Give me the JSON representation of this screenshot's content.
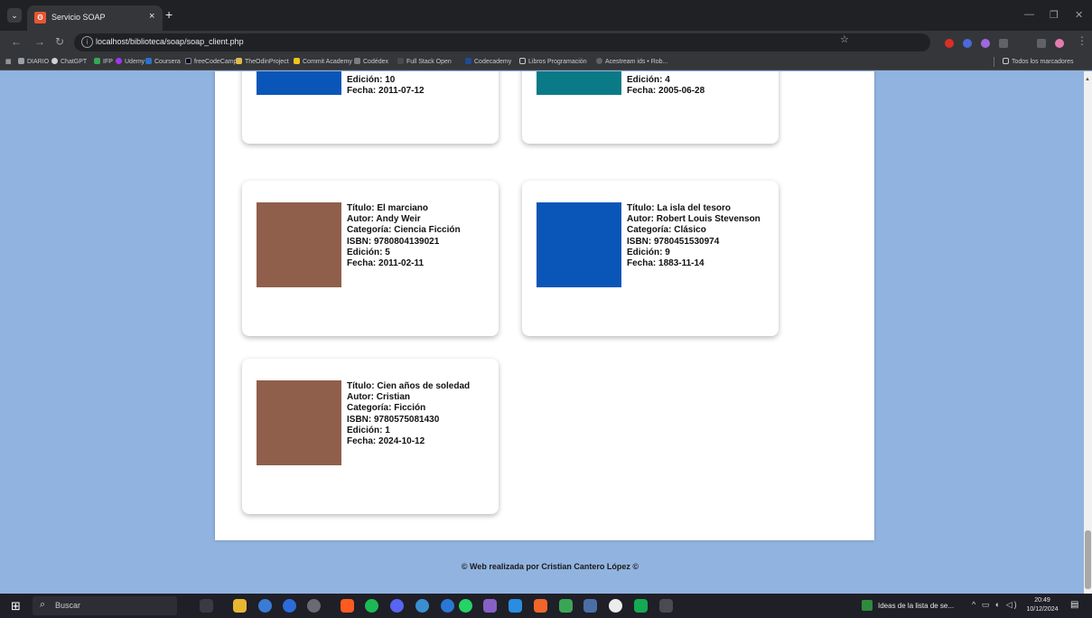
{
  "browser": {
    "tab_title": "Servicio SOAP",
    "tab_close": "×",
    "new_tab": "+",
    "url": "localhost/biblioteca/soap/soap_client.php",
    "bookmarks": [
      {
        "label": "DIARIO",
        "color": "#9aa0a6"
      },
      {
        "label": "ChatGPT",
        "color": "#cfd1d4"
      },
      {
        "label": "IFP",
        "color": "#35a853"
      },
      {
        "label": "Udemy",
        "color": "#a435f0"
      },
      {
        "label": "Coursera",
        "color": "#2a73cc"
      },
      {
        "label": "freeCodeCamp",
        "color": "#0a0a23"
      },
      {
        "label": "TheOdinProject",
        "color": "#e0b94b"
      },
      {
        "label": "Commit Academy",
        "color": "#f0c419"
      },
      {
        "label": "Codédex",
        "color": "#7d7d7d"
      },
      {
        "label": "Full Stack Open",
        "color": "#4a4a4a"
      },
      {
        "label": "Codecademy",
        "color": "#1f4b99"
      },
      {
        "label": "Libros Programación",
        "color": "#9aa0a6"
      },
      {
        "label": "Acestream ids • Rob...",
        "color": "#5f6368"
      }
    ],
    "all_bookmarks": "Todos los marcadores"
  },
  "books": [
    {
      "title": "",
      "author": "",
      "category": "",
      "isbn": "",
      "edition": "Edición: 10",
      "date": "Fecha: 2011-07-12",
      "cover_color": "#0a56b8"
    },
    {
      "title": "",
      "author": "",
      "category": "",
      "isbn": "",
      "edition": "Edición: 4",
      "date": "Fecha: 2005-06-28",
      "cover_color": "#0b7a87"
    },
    {
      "title": "Título: El marciano",
      "author": "Autor: Andy Weir",
      "category": "Categoría: Ciencia Ficción",
      "isbn": "ISBN: 9780804139021",
      "edition": "Edición: 5",
      "date": "Fecha: 2011-02-11",
      "cover_color": "#8f5f4b"
    },
    {
      "title": "Título: La isla del tesoro",
      "author": "Autor: Robert Louis Stevenson",
      "category": "Categoría: Clásico",
      "isbn": "ISBN: 9780451530974",
      "edition": "Edición: 9",
      "date": "Fecha: 1883-11-14",
      "cover_color": "#0a56b8"
    },
    {
      "title": "Título: Cien años de soledad",
      "author": "Autor: Cristian",
      "category": "Categoría: Ficción",
      "isbn": "ISBN: 9780575081430",
      "edition": "Edición: 1",
      "date": "Fecha: 2024-10-12",
      "cover_color": "#8f5f4b"
    }
  ],
  "footer": "© Web realizada por Cristian Cantero López ©",
  "taskbar": {
    "search_placeholder": "Buscar",
    "notification": "Ideas de la lista de se...",
    "time": "20:49",
    "date": "10/12/2024"
  }
}
